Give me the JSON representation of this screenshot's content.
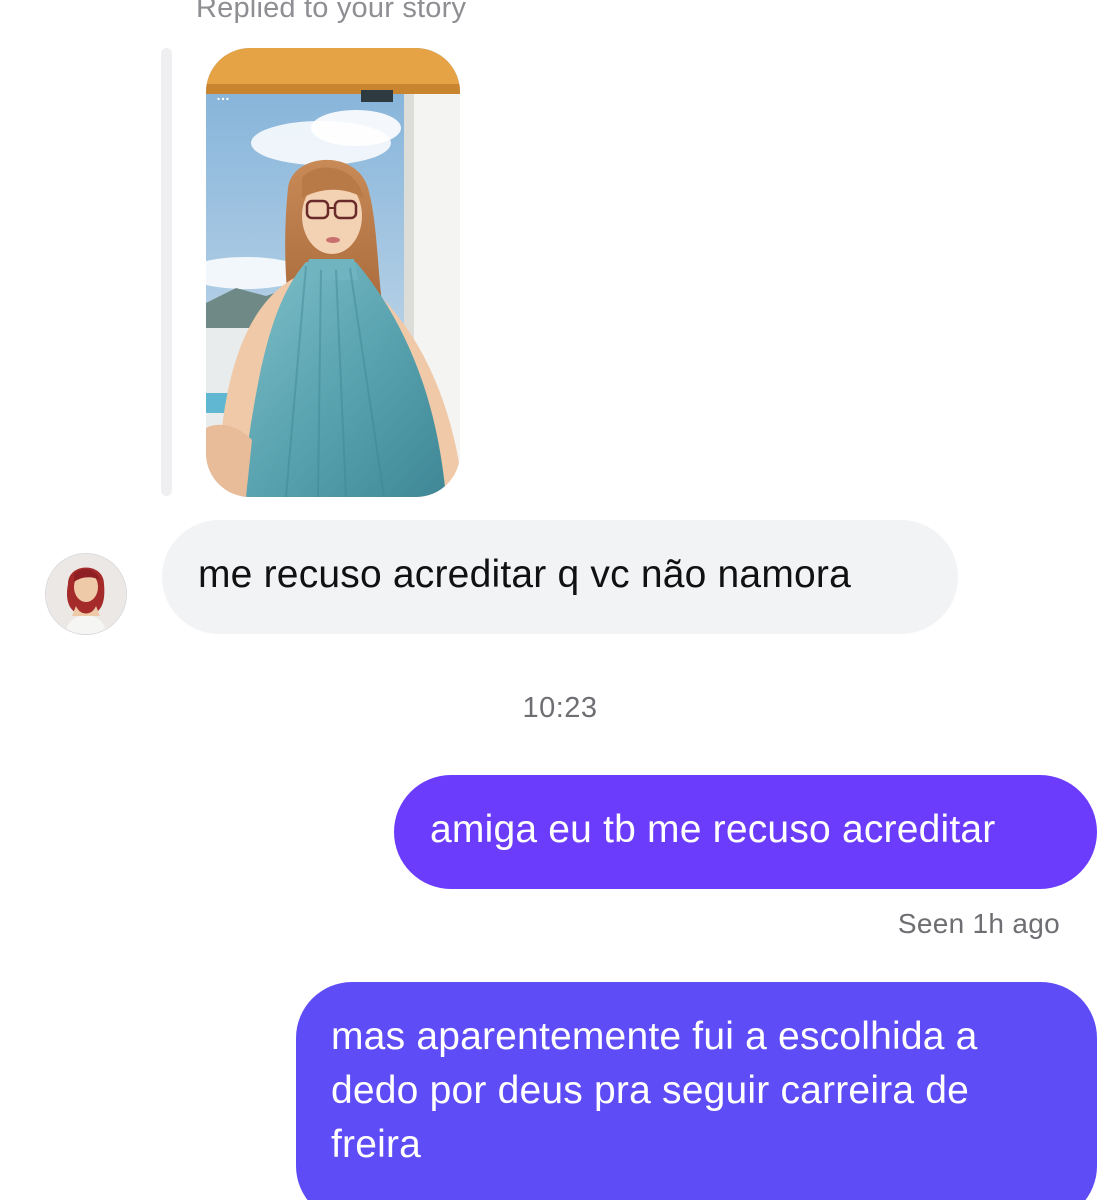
{
  "story_reply": {
    "label": "Replied to your story",
    "more_icon": "…"
  },
  "conversation": {
    "received": {
      "text": "me recuso acreditar q vc não namora"
    },
    "timestamp": "10:23",
    "sent": [
      {
        "text": "amiga eu tb me recuso acreditar"
      },
      {
        "text": "mas aparentemente fui a escolhida a dedo por deus pra seguir carreira de freira"
      }
    ],
    "seen_status": "Seen 1h ago"
  },
  "colors": {
    "received_bubble": "#f2f3f5",
    "sent_bubble_1": "#6b3cfb",
    "sent_bubble_2": "#5e4cf6",
    "meta_text": "#8e8e93"
  }
}
